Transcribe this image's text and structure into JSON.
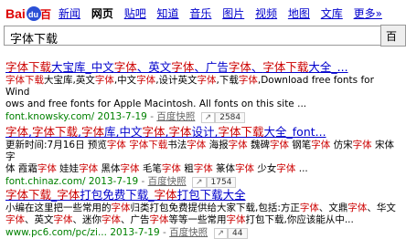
{
  "logo": {
    "text_bai": "Bai",
    "text_du": "du",
    "text_cn": "百度"
  },
  "nav": [
    {
      "label": "新闻",
      "current": false
    },
    {
      "label": "网页",
      "current": true
    },
    {
      "label": "贴吧",
      "current": false
    },
    {
      "label": "知道",
      "current": false
    },
    {
      "label": "音乐",
      "current": false
    },
    {
      "label": "图片",
      "current": false
    },
    {
      "label": "视频",
      "current": false
    },
    {
      "label": "地图",
      "current": false
    },
    {
      "label": "文库",
      "current": false
    },
    {
      "label": "更多»",
      "current": false
    }
  ],
  "search": {
    "query": "字体下载",
    "button_label": "百"
  },
  "results": [
    {
      "title": "字体下载大宝库_中文字体、英文字体、广告字体、字体下载大全_...",
      "abstract_l1": "字体下载大宝库,英文字体,中文字体,设计英文字体,下载字体,Download free fonts for Wind",
      "abstract_l2": "ows and free fonts for Apple Macintosh. All fonts on this site ...",
      "url": "font.knowsky.com/",
      "date": "2013-7-19",
      "snapshot": "百度快照",
      "share_count": "2584"
    },
    {
      "title": "字体,字体下载,字体库,中文字体,字体设计,字体下载大全_font...",
      "abstract_l1": "更新时间:7月16日 预览字体 字体下载书法字体 海报字体 魏碑字体 钢笔字体 仿宋字体 宋体字",
      "abstract_l2": "体 霞霜字体 娃娃字体 黑体字体 毛笔字体 粗字体 篆体字体 少女字体 ...",
      "url": "font.chinaz.com/",
      "date": "2013-7-19",
      "snapshot": "百度快照",
      "share_count": "1754"
    },
    {
      "title": "字体下载_字体打包免费下载_字体打包下载大全",
      "abstract_l1": "小编在这里把一些常用的字体归类打包免费提供给大家下载,包括:方正字体、文鼎字体、华文",
      "abstract_l2": "字体、英文字体、迷你字体、广告字体等等一些常用字体打包下载,你应该能从中...",
      "url": "www.pc6.com/pc/zi...",
      "date": "2013-7-19",
      "snapshot": "百度快照",
      "share_count": "44"
    }
  ]
}
